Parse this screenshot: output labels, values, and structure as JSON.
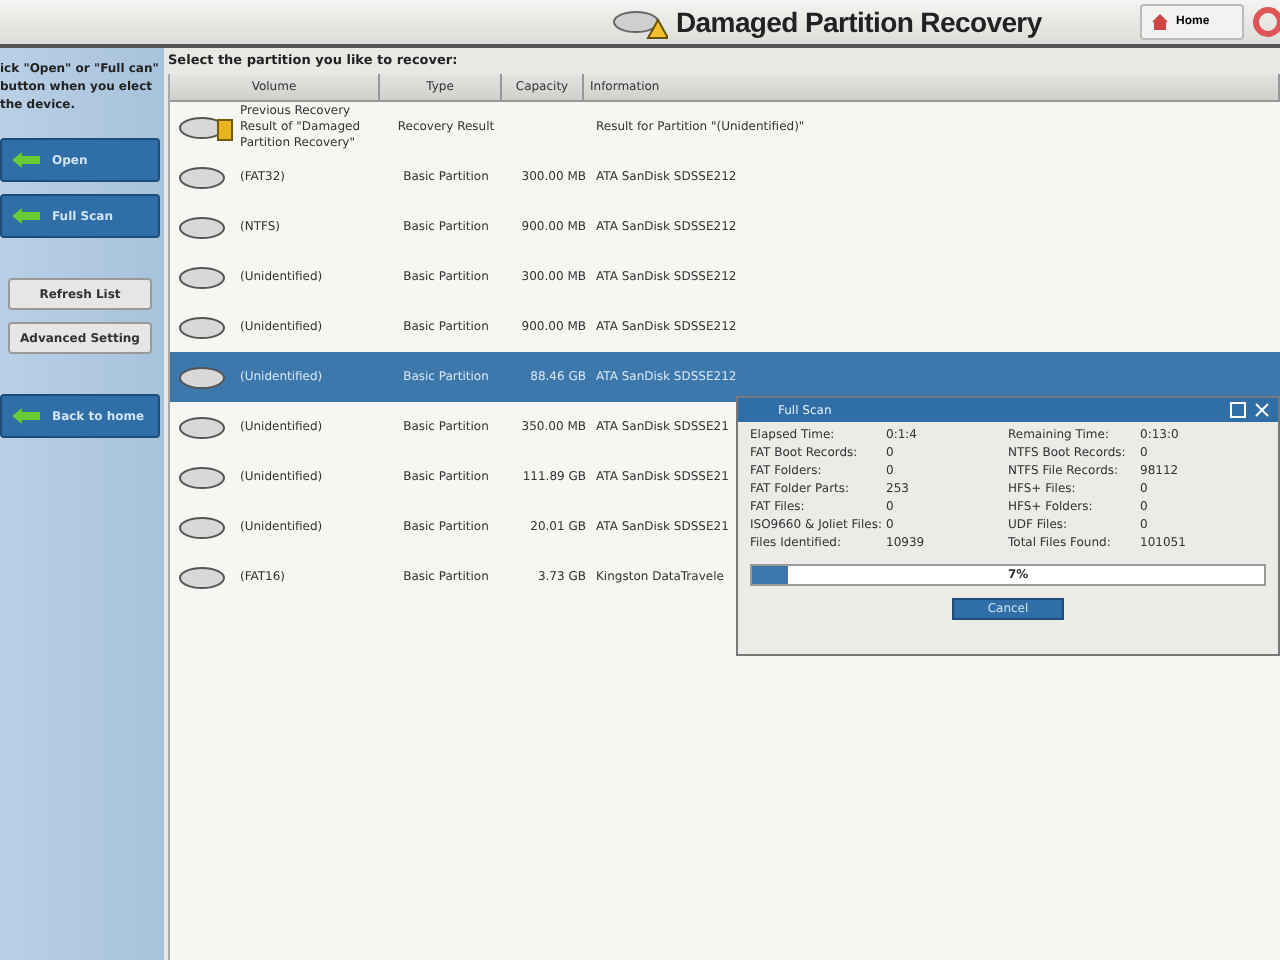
{
  "header": {
    "title": "Damaged Partition Recovery",
    "home_button": "Home"
  },
  "sidebar": {
    "instruction": "ick \"Open\" or \"Full can\" button when you elect the device.",
    "buttons": [
      {
        "label": "Open",
        "kind": "primary"
      },
      {
        "label": "Full Scan",
        "kind": "primary"
      },
      {
        "label": "Refresh List",
        "kind": "secondary"
      },
      {
        "label": "Advanced Setting",
        "kind": "secondary"
      },
      {
        "label": "Back to home",
        "kind": "primary"
      }
    ]
  },
  "prompt": "Select the partition you like to recover:",
  "table": {
    "columns": [
      "Volume",
      "Type",
      "Capacity",
      "Information"
    ],
    "rows": [
      {
        "kind": "recovery",
        "volume": "Previous Recovery Result of \"Damaged Partition Recovery\"",
        "type": "Recovery Result",
        "capacity": "",
        "information": "Result for Partition \"(Unidentified)\"",
        "selected": false
      },
      {
        "kind": "partition",
        "volume": "(FAT32)",
        "type": "Basic Partition",
        "capacity": "300.00 MB",
        "information": "ATA SanDisk SDSSE212",
        "selected": false
      },
      {
        "kind": "partition",
        "volume": "(NTFS)",
        "type": "Basic Partition",
        "capacity": "900.00 MB",
        "information": "ATA SanDisk SDSSE212",
        "selected": false
      },
      {
        "kind": "partition",
        "volume": "(Unidentified)",
        "type": "Basic Partition",
        "capacity": "300.00 MB",
        "information": "ATA SanDisk SDSSE212",
        "selected": false
      },
      {
        "kind": "partition",
        "volume": "(Unidentified)",
        "type": "Basic Partition",
        "capacity": "900.00 MB",
        "information": "ATA SanDisk SDSSE212",
        "selected": false
      },
      {
        "kind": "partition",
        "volume": "(Unidentified)",
        "type": "Basic Partition",
        "capacity": "88.46 GB",
        "information": "ATA SanDisk SDSSE212",
        "selected": true
      },
      {
        "kind": "partition",
        "volume": "(Unidentified)",
        "type": "Basic Partition",
        "capacity": "350.00 MB",
        "information": "ATA SanDisk SDSSE21",
        "selected": false
      },
      {
        "kind": "partition",
        "volume": "(Unidentified)",
        "type": "Basic Partition",
        "capacity": "111.89 GB",
        "information": "ATA SanDisk SDSSE21",
        "selected": false
      },
      {
        "kind": "partition",
        "volume": "(Unidentified)",
        "type": "Basic Partition",
        "capacity": "20.01 GB",
        "information": "ATA SanDisk SDSSE21",
        "selected": false
      },
      {
        "kind": "partition",
        "volume": "(FAT16)",
        "type": "Basic Partition",
        "capacity": "3.73 GB",
        "information": "Kingston DataTravele",
        "selected": false
      }
    ]
  },
  "dialog": {
    "title": "Full Scan",
    "stats": [
      {
        "label": "Elapsed Time:",
        "value": "0:1:4"
      },
      {
        "label": "Remaining Time:",
        "value": "0:13:0"
      },
      {
        "label": "FAT Boot Records:",
        "value": "0"
      },
      {
        "label": "NTFS Boot Records:",
        "value": "0"
      },
      {
        "label": "FAT Folders:",
        "value": "0"
      },
      {
        "label": "NTFS File Records:",
        "value": "98112"
      },
      {
        "label": "FAT Folder Parts:",
        "value": "253"
      },
      {
        "label": "HFS+ Files:",
        "value": "0"
      },
      {
        "label": "FAT Files:",
        "value": "0"
      },
      {
        "label": "HFS+ Folders:",
        "value": "0"
      },
      {
        "label": "ISO9660 & Joliet Files:",
        "value": "0"
      },
      {
        "label": "UDF Files:",
        "value": "0"
      },
      {
        "label": "Files Identified:",
        "value": "10939"
      },
      {
        "label": "Total Files Found:",
        "value": "101051"
      }
    ],
    "progress": {
      "level": 0.07,
      "text": "7%"
    },
    "cancel_button": "Cancel"
  }
}
